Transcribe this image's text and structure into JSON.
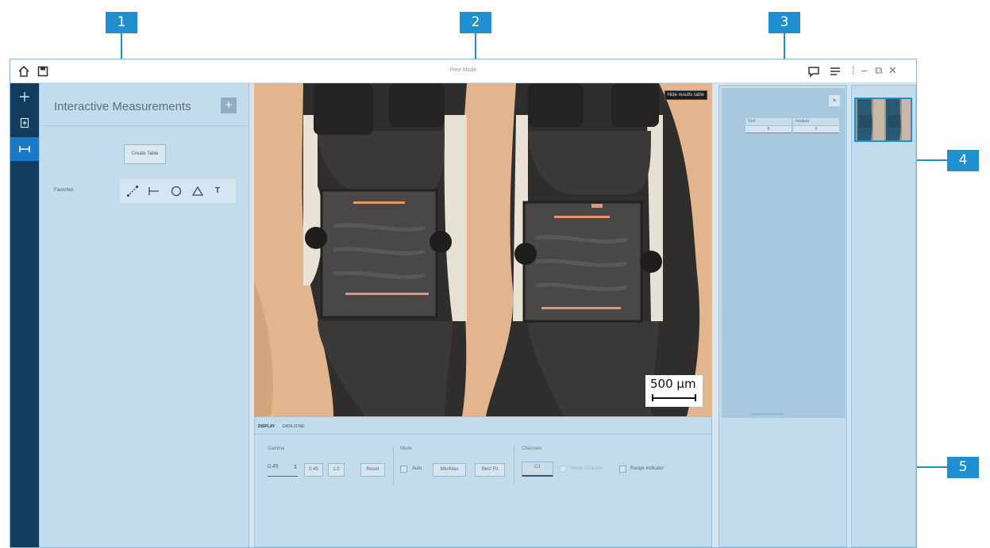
{
  "window": {
    "title": "Free Mode"
  },
  "callouts": [
    "1",
    "2",
    "3",
    "4",
    "5"
  ],
  "left_toolbar": {
    "icons": [
      "plus-icon",
      "document-add-icon",
      "measure-icon"
    ]
  },
  "measurements_panel": {
    "title": "Interactive Measurements",
    "add_label": "+",
    "create_table_label": "Create Table",
    "favorites_label": "Favorites",
    "tools": [
      "line-tool-icon",
      "distance-tool-icon",
      "circle-tool-icon",
      "angle-tool-icon",
      "text-tool-icon"
    ],
    "text_tool_label": "T"
  },
  "image": {
    "hide_results_label": "Hide results table",
    "scale_label": "500 µm"
  },
  "bottom_panel": {
    "tabs": [
      "DISPLAY",
      "DATA ZONE"
    ],
    "gamma": {
      "label": "Gamma",
      "value": "0.45",
      "buttons": [
        "0.45",
        "1.0",
        "Reset"
      ]
    },
    "mode": {
      "label": "Mode",
      "auto_label": "Auto",
      "buttons": [
        "Min/Max",
        "Best Fit"
      ]
    },
    "channels": {
      "label": "Channels",
      "selected": "C1",
      "single_channel_label": "Single Channel",
      "range_indicator_label": "Range Indicator"
    }
  },
  "results_panel": {
    "close_label": "×",
    "headers": [
      "Tool",
      "Feature"
    ],
    "row": [
      "0",
      "0"
    ]
  },
  "colors": {
    "accent": "#1f8fd0",
    "sidebar": "#123c5e",
    "panel": "#c2dcee",
    "copper": "#e2b58f"
  }
}
